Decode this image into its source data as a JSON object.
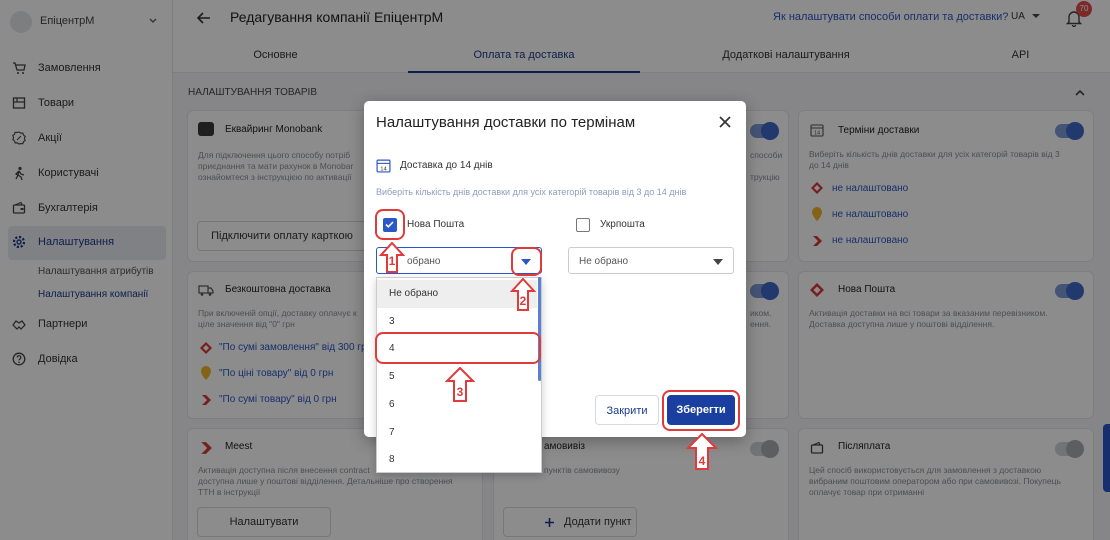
{
  "app": {
    "brand_name": "ЕпіцентрМ",
    "page_title": "Редагування компанії ЕпіцентрМ",
    "help_link": "Як налаштувати способи оплати та доставки?",
    "language": "UA",
    "notifications_count": "70"
  },
  "sidebar": {
    "items": [
      {
        "label": "Замовлення",
        "icon": "cart-icon"
      },
      {
        "label": "Товари",
        "icon": "box-icon"
      },
      {
        "label": "Акції",
        "icon": "percent-icon"
      },
      {
        "label": "Користувачі",
        "icon": "users-icon"
      },
      {
        "label": "Бухгалтерія",
        "icon": "wallet-icon"
      },
      {
        "label": "Налаштування",
        "icon": "gear-icon"
      },
      {
        "label": "Партнери",
        "icon": "handshake-icon"
      },
      {
        "label": "Довідка",
        "icon": "help-icon"
      }
    ],
    "subitems": [
      "Налаштування атрибутів",
      "Налаштування компанії"
    ]
  },
  "tabs": [
    "Основне",
    "Оплата та доставка",
    "Додаткові налаштування",
    "API"
  ],
  "section": {
    "title": "НАЛАШТУВАННЯ ТОВАРІВ"
  },
  "cards": {
    "monobank": {
      "title": "Еквайринг Monobank",
      "text": [
        "Для підключення цього способу потріб",
        "приєднання та мати рахунок в Monobar",
        "ознайомтеся з інструкцією по активації"
      ],
      "link": "інструкцією",
      "button": "Підключити оплату карткою"
    },
    "middle_top": {
      "text": [
        "способи",
        "трукцію"
      ]
    },
    "terms": {
      "title": "Терміни доставки",
      "text": [
        "Виберіть кількість днів доставки для усіх категорій товарів від 3",
        "до 14 днів"
      ],
      "carriers": [
        "не налаштовано",
        "не налаштовано",
        "не налаштовано"
      ]
    },
    "free": {
      "title": "Безкоштовна доставка",
      "text": [
        "При включеній опції, доставку оплачує к",
        "ціле значення від \"0\" грн"
      ],
      "rules": [
        "\"По сумі замовлення\" від 300 грн",
        "\"По ціні товару\" від 0 грн",
        "\"По сумі товару\" від 0 грн"
      ]
    },
    "middle_mid": {
      "text": [
        "иком.",
        "ення."
      ]
    },
    "novaposhta": {
      "title": "Нова Пошта",
      "text": [
        "Активація доставки на всі товари за вказаним перевізником.",
        "Доставка доступна лише у поштові відділення."
      ]
    },
    "meest": {
      "title": "Meest",
      "text": [
        "Активація доступна після внесення contract",
        "доступна лише у поштові відділення. Детальніше про створення",
        "ТТН в інструкції"
      ],
      "link": "інструкції",
      "button": "Налаштувати"
    },
    "pickup": {
      "title": "амовивіз",
      "text": [
        "пунктів самовивозу"
      ],
      "button": "Додати пункт"
    },
    "cod": {
      "title": "Післяплата",
      "text": [
        "Цей спосіб використовується для замовлення з доставкою",
        "вибраним поштовим оператором або при самовивозі. Покупець",
        "оплачує товар при отриманні"
      ]
    }
  },
  "dialog": {
    "title": "Налаштування доставки по термінам",
    "subtitle": "Доставка до 14 днів",
    "hint": "Виберіть кількість днів доставки для усіх категорій товарів від 3 до 14 днів",
    "carrier1": {
      "label": "Нова Пошта",
      "checked": true,
      "select_value": "обрано"
    },
    "carrier2": {
      "label": "Укрпошта",
      "checked": false,
      "select_value": "Не обрано"
    },
    "options": [
      "Не обрано",
      "3",
      "4",
      "5",
      "6",
      "7",
      "8"
    ],
    "cancel": "Закрити",
    "save": "Зберегти"
  },
  "annotations": [
    "1",
    "2",
    "3",
    "4"
  ],
  "colors": {
    "accent": "#1c3a8c",
    "primary_button": "#1a3fa0",
    "annotation": "#e03a3a",
    "toggle_on": "#3f69c9"
  }
}
